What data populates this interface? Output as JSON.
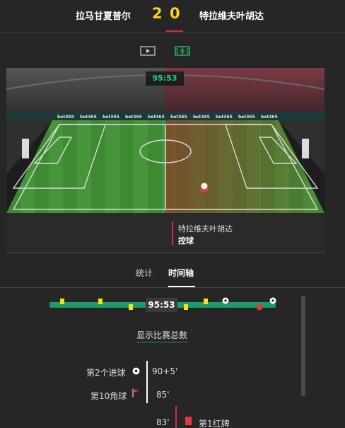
{
  "match": {
    "home_team": "拉马甘夏普尔",
    "away_team": "特拉维夫叶胡达",
    "home_score": "2",
    "away_score": "0",
    "accent_color": "#d12b4b",
    "score_color": "#ffd21a"
  },
  "view_toggles": [
    {
      "name": "video",
      "icon": "play-icon"
    },
    {
      "name": "pitch",
      "icon": "pitch-icon"
    }
  ],
  "pitch": {
    "clock": "95:53",
    "ad_text": "bet365",
    "event_team": "特拉维夫叶胡达",
    "event_type": "控球"
  },
  "tabs": [
    {
      "label": "统计",
      "active": false
    },
    {
      "label": "时间轴",
      "active": true
    }
  ],
  "timeline": {
    "clock": "95:53",
    "show_total_label": "显示比赛总数",
    "track_color": "#1e9a6c"
  },
  "events": [
    {
      "label": "第2个进球",
      "minute": "90+5'",
      "icon": "soccer-ball-icon",
      "side": "home"
    },
    {
      "label": "第10角球",
      "minute": "85'",
      "icon": "corner-flag-icon",
      "side": "home"
    },
    {
      "label": "第1红牌",
      "minute": "83'",
      "icon": "red-card-icon",
      "side": "away"
    }
  ]
}
